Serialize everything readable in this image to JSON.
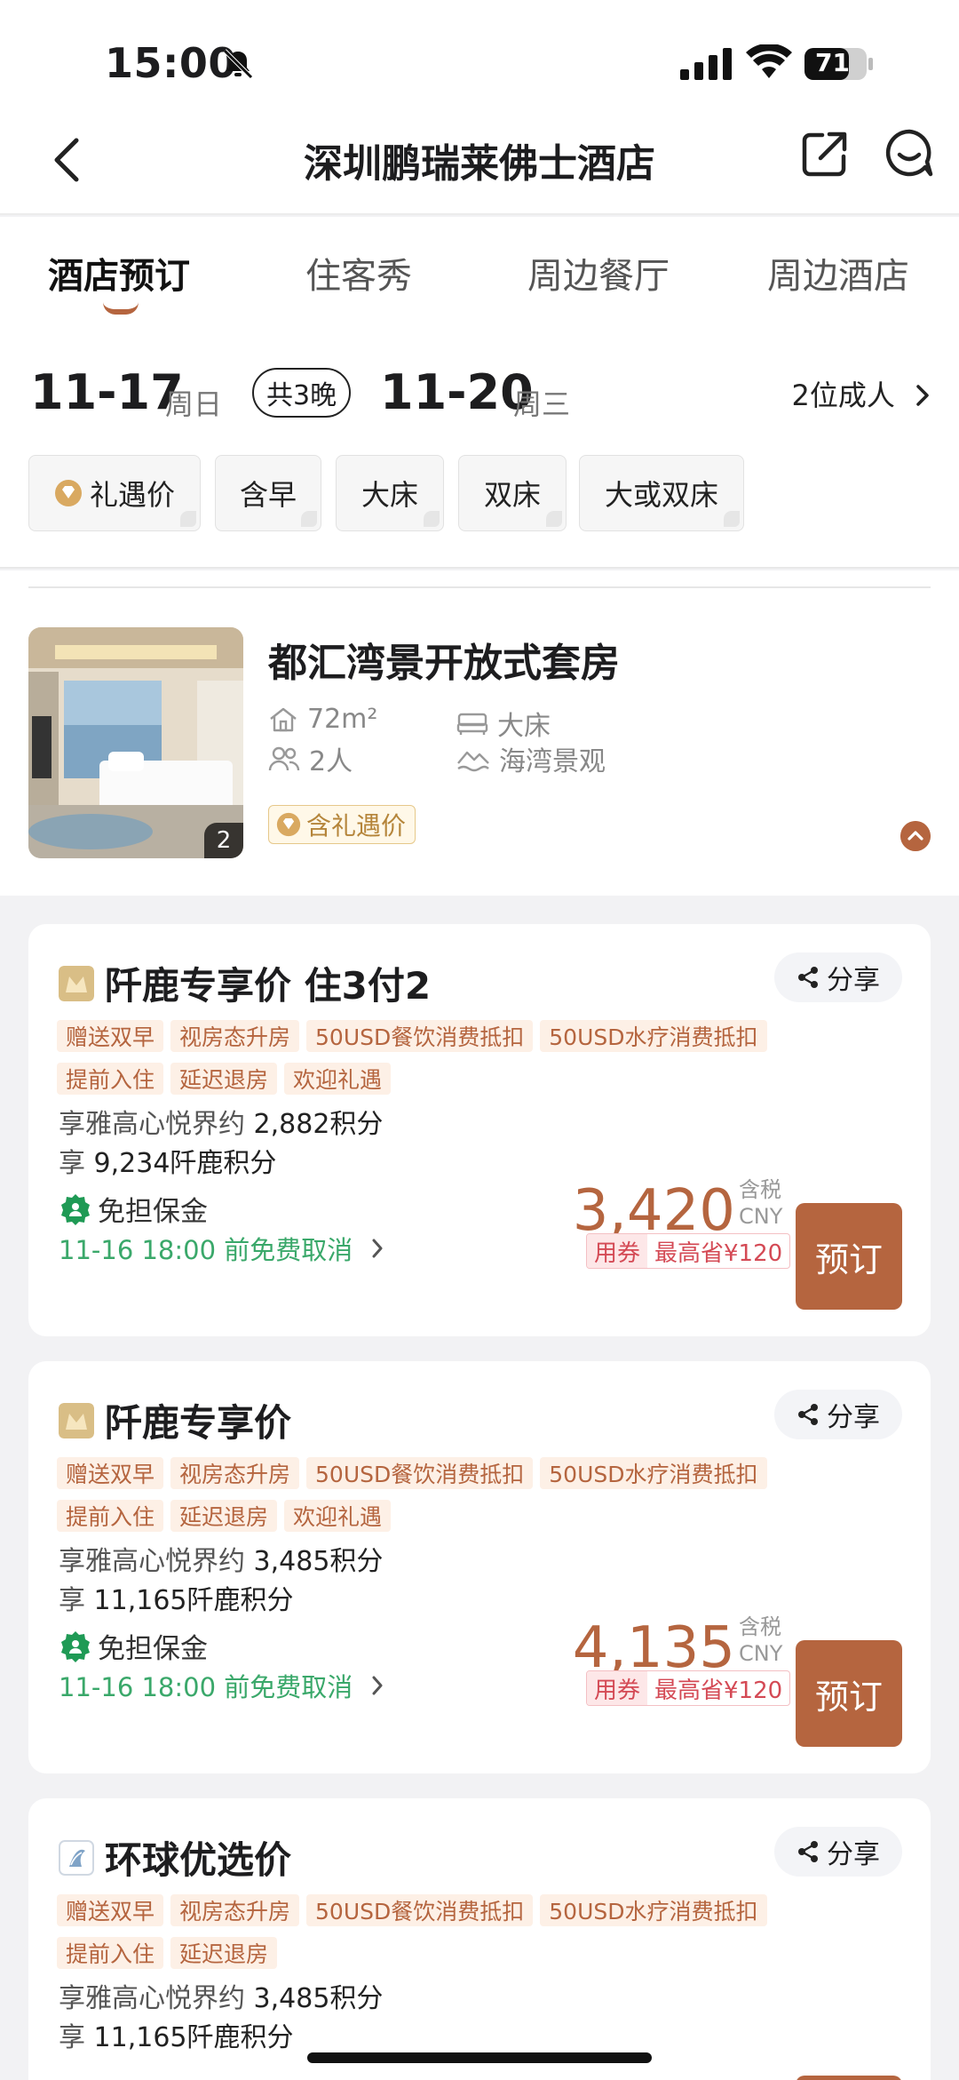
{
  "status_bar": {
    "time": "15:00",
    "battery": "71"
  },
  "header": {
    "title": "深圳鹏瑞莱佛士酒店"
  },
  "tabs": [
    "酒店预订",
    "住客秀",
    "周边餐厅",
    "周边酒店"
  ],
  "dates": {
    "checkin": "11-17",
    "checkin_day": "周日",
    "nights": "共3晚",
    "checkout": "11-20",
    "checkout_day": "周三",
    "guests": "2位成人"
  },
  "filters": [
    "礼遇价",
    "含早",
    "大床",
    "双床",
    "大或双床"
  ],
  "room": {
    "name": "都汇湾景开放式套房",
    "area": "72m²",
    "bed": "大床",
    "occupancy": "2人",
    "view": "海湾景观",
    "photo_count": "2",
    "tag": "含礼遇价"
  },
  "rates": [
    {
      "title": "阡鹿专享价 住3付2",
      "share": "分享",
      "perks": [
        "赠送双早",
        "视房态升房",
        "50USD餐饮消费抵扣",
        "50USD水疗消费抵扣",
        "提前入住",
        "延迟退房",
        "欢迎礼遇"
      ],
      "points1_label": "享雅高心悦界约",
      "points1": "2,882积分",
      "points2_label": "享",
      "points2": "9,234阡鹿积分",
      "deposit": "免担保金",
      "cancel": "11-16 18:00 前免费取消",
      "price": "3,420",
      "tax": "含税",
      "currency": "CNY",
      "coupon_label": "用券",
      "coupon_saving": "最高省¥120",
      "book": "预订"
    },
    {
      "title": "阡鹿专享价",
      "share": "分享",
      "perks": [
        "赠送双早",
        "视房态升房",
        "50USD餐饮消费抵扣",
        "50USD水疗消费抵扣",
        "提前入住",
        "延迟退房",
        "欢迎礼遇"
      ],
      "points1_label": "享雅高心悦界约",
      "points1": "3,485积分",
      "points2_label": "享",
      "points2": "11,165阡鹿积分",
      "deposit": "免担保金",
      "cancel": "11-16 18:00 前免费取消",
      "price": "4,135",
      "tax": "含税",
      "currency": "CNY",
      "coupon_label": "用券",
      "coupon_saving": "最高省¥120",
      "book": "预订"
    },
    {
      "title": "环球优选价",
      "share": "分享",
      "perks": [
        "赠送双早",
        "视房态升房",
        "50USD餐饮消费抵扣",
        "50USD水疗消费抵扣",
        "提前入住",
        "延迟退房"
      ],
      "points1_label": "享雅高心悦界约",
      "points1": "3,485积分",
      "points2_label": "享",
      "points2": "11,165阡鹿积分"
    }
  ],
  "colors": {
    "accent": "#b5653f",
    "green": "#3aa86a",
    "coupon_red": "#d44a55",
    "gold": "#b5853a"
  }
}
